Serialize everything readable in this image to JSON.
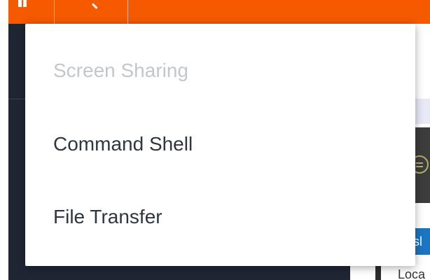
{
  "app": {
    "accent_color": "#f55a00",
    "topbar_icons": [
      "grid-icon",
      "search-icon"
    ]
  },
  "context_menu": {
    "items": [
      {
        "label": "Screen Sharing",
        "enabled": false
      },
      {
        "label": "Command Shell",
        "enabled": true
      },
      {
        "label": "File Transfer",
        "enabled": true
      }
    ]
  },
  "background_panel": {
    "blue_tab_text": "asl",
    "location_text": "Loca",
    "status_icon": "exchange-icon"
  }
}
